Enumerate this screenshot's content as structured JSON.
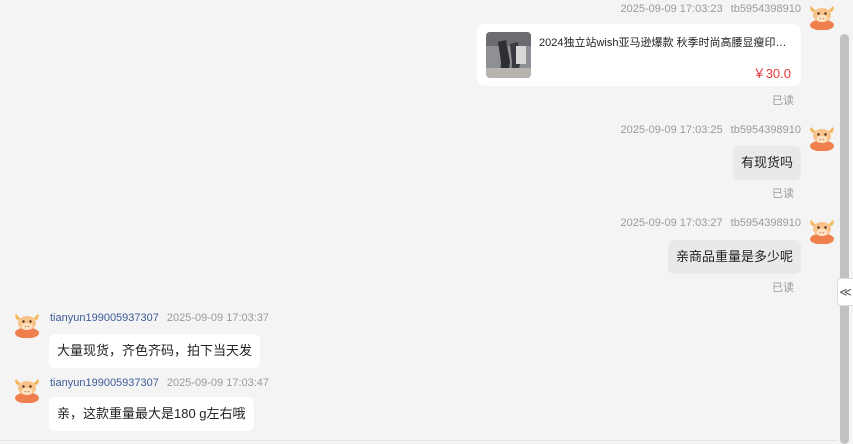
{
  "colors": {
    "background": "#f4f4f4",
    "price": "#e4393c",
    "sender_name": "#3d5a96",
    "avatar": "#f07f4e"
  },
  "messages": [
    {
      "side": "right",
      "sender": "tb5954398910",
      "time": "2025-09-09 17:03:23",
      "type": "product-card",
      "product": {
        "title": "2024独立站wish亚马逊爆款 秋季时尚高腰显瘦印花...",
        "price": "￥30.0"
      },
      "status": "已读"
    },
    {
      "side": "right",
      "sender": "tb5954398910",
      "time": "2025-09-09 17:03:25",
      "text": "有现货吗",
      "status": "已读"
    },
    {
      "side": "right",
      "sender": "tb5954398910",
      "time": "2025-09-09 17:03:27",
      "text": "亲商品重量是多少呢",
      "status": "已读"
    },
    {
      "side": "left",
      "sender": "tianyun199005937307",
      "time": "2025-09-09 17:03:37",
      "text": "大量现货，齐色齐码，拍下当天发"
    },
    {
      "side": "left",
      "sender": "tianyun199005937307",
      "time": "2025-09-09 17:03:47",
      "text": "亲，这款重量最大是180 g左右哦"
    }
  ],
  "icons": {
    "avatar": "cartoon-cow-avatar-icon",
    "collapse": "double-chevron-left-icon"
  },
  "collapse_glyph": "≪"
}
